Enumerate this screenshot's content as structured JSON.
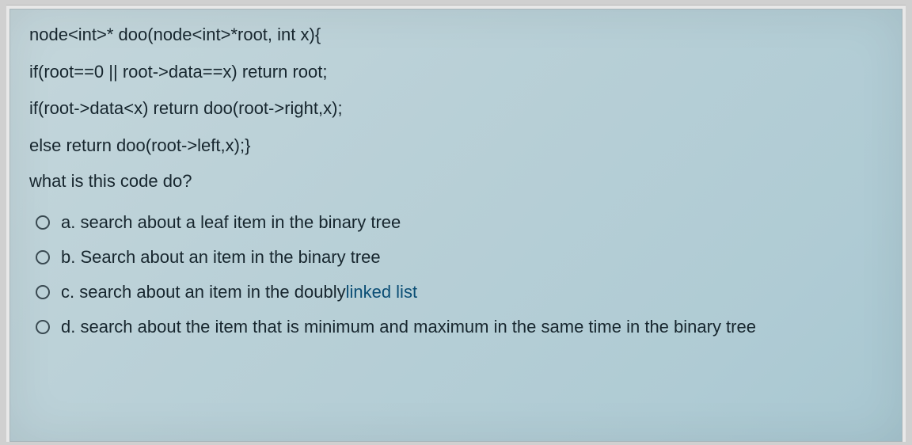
{
  "code_lines": [
    "node<int>* doo(node<int>*root, int x){",
    "if(root==0 || root->data==x) return root;",
    "if(root->data<x) return doo(root->right,x);",
    "else return doo(root->left,x);}"
  ],
  "question": "what is this code do?",
  "options": [
    {
      "letter": "a.",
      "text": "search about a leaf item in the binary tree",
      "link_word": ""
    },
    {
      "letter": "b.",
      "text": "Search about an item in the binary tree",
      "link_word": ""
    },
    {
      "letter": "c.",
      "text_before": "search about an item in the doubly ",
      "link_word": "linked list",
      "text_after": ""
    },
    {
      "letter": "d.",
      "text": "search about the item that is minimum and maximum in the same time in the binary tree",
      "link_word": ""
    }
  ]
}
